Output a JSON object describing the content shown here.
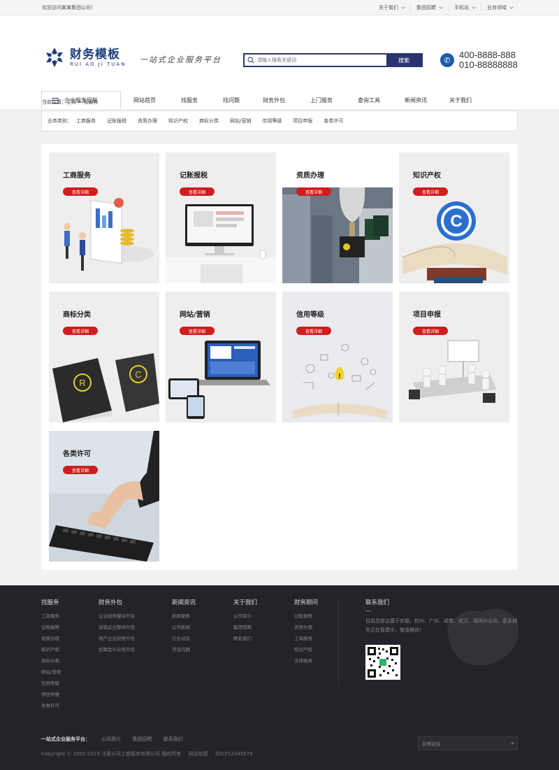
{
  "topbar": {
    "welcome": "欢迎访问某某集团公司！",
    "links": [
      "关于我们",
      "集团招聘",
      "手机站",
      "业务领域"
    ]
  },
  "header": {
    "logo_cn": "财务模板",
    "logo_en": "RUI AO JI TUAN",
    "slogan": "一站式企业服务平台",
    "search_placeholder": "请输入搜索关键词",
    "search_button": "搜索",
    "phone1": "400-8888-888",
    "phone2": "010-88888888"
  },
  "nav": {
    "category_label": "企业服务导航",
    "items": [
      "网站首页",
      "找服务",
      "找问题",
      "财务外包",
      "上门服务",
      "查询工具",
      "新闻资讯",
      "关于我们"
    ]
  },
  "breadcrumb": "当前位置：主页 > 找服务",
  "filter": {
    "label": "业务类别：",
    "items": [
      "工商服务",
      "记账报税",
      "资质办理",
      "知识产权",
      "商标分类",
      "网站/营销",
      "信用等级",
      "项目申报",
      "各类许可"
    ]
  },
  "cards": [
    {
      "title": "工商服务",
      "button": "查看详细"
    },
    {
      "title": "记账报税",
      "button": "查看详细"
    },
    {
      "title": "资质办理",
      "button": "查看详细"
    },
    {
      "title": "知识产权",
      "button": "查看详细"
    },
    {
      "title": "商标分类",
      "button": "查看详细"
    },
    {
      "title": "网站/营销",
      "button": "查看详细"
    },
    {
      "title": "信用等级",
      "button": "查看详细"
    },
    {
      "title": "项目申报",
      "button": "查看详细"
    },
    {
      "title": "各类许可",
      "button": "查看详细"
    }
  ],
  "footer": {
    "columns": [
      {
        "title": "找服务",
        "items": [
          "工商服务",
          "记账报税",
          "资质办理",
          "知识产权",
          "商标分类",
          "网站/营销",
          "信用等级",
          "项目申报",
          "各类许可"
        ]
      },
      {
        "title": "财务外包",
        "items": [
          "企业财务模块外包",
          "连锁企业整体外包",
          "地产企业财务外包",
          "招聘会计业务外包"
        ]
      },
      {
        "title": "新闻资讯",
        "items": [
          "新闻聚焦",
          "公司新闻",
          "行业动态",
          "常见问题"
        ]
      },
      {
        "title": "关于我们",
        "items": [
          "公司简介",
          "集团招聘",
          "联系我们"
        ]
      },
      {
        "title": "财务顾问",
        "items": [
          "记账报税",
          "资质办理",
          "工商服务",
          "知识产权",
          "法律服务"
        ]
      }
    ],
    "contact_title": "联系我们",
    "contact_desc": "目前总部设置于安徽、杭州、广州、成都、武汉、深圳分公司，更多城市正在筹建中，敬请期待！",
    "bottom_label": "一站式企业服务平台：",
    "bottom_links": [
      "公司简介",
      "集团招聘",
      "联系我们"
    ],
    "copyright": "Copyright © 2002-2019 注册公司工商服务有限公司 版权所有",
    "sitemap": "网站地图",
    "icp": "苏ICP12345678",
    "friend_links": "友情链接"
  },
  "colors": {
    "primary": "#2a3570",
    "accent": "#d01d1d",
    "footer_bg": "#232329"
  }
}
